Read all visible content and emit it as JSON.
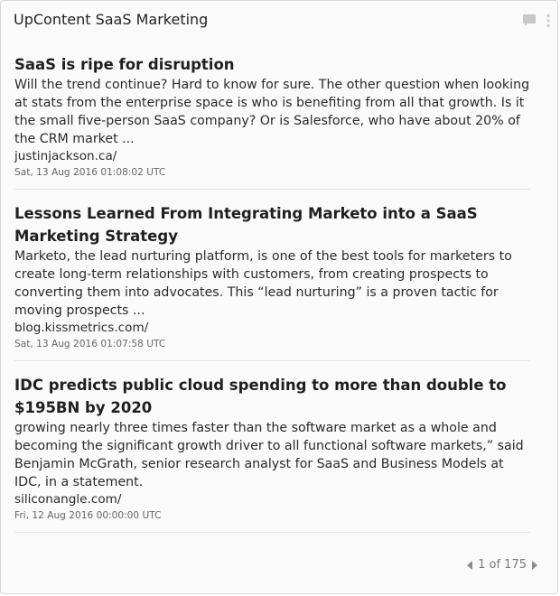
{
  "widget": {
    "title": "UpContent SaaS Marketing",
    "icons": [
      "comment-icon",
      "kebab-menu-icon"
    ]
  },
  "articles": [
    {
      "title": "SaaS is ripe for disruption",
      "description": "Will the trend continue? Hard to know for sure. The other question when looking at stats from the enterprise space is who is benefiting from all that growth. Is it the small five-person SaaS company? Or is Salesforce, who have about 20% of the CRM market ...",
      "source": "justinjackson.ca/",
      "date": "Sat, 13 Aug 2016 01:08:02 UTC"
    },
    {
      "title": "Lessons Learned From Integrating Marketo into a SaaS Marketing Strategy",
      "description": "Marketo, the lead nurturing platform, is one of the best tools for marketers to create long-term relationships with customers, from creating prospects to converting them into advocates. This “lead nurturing” is a proven tactic for moving prospects ...",
      "source": "blog.kissmetrics.com/",
      "date": "Sat, 13 Aug 2016 01:07:58 UTC"
    },
    {
      "title": "IDC predicts public cloud spending to more than double to $195BN by 2020",
      "description": "growing nearly three times faster than the software market as a whole and becoming the significant growth driver to all functional software markets,” said Benjamin McGrath, senior research analyst for SaaS and Business Models at IDC, in a statement.",
      "source": "siliconangle.com/",
      "date": "Fri, 12 Aug 2016 00:00:00 UTC"
    }
  ],
  "pagination": {
    "text": "1 of 175",
    "current": 1,
    "total": 175
  },
  "colors": {
    "text": "#222222",
    "muted": "#666666",
    "divider": "#e3e3e3",
    "icon": "#c8c8c8"
  }
}
